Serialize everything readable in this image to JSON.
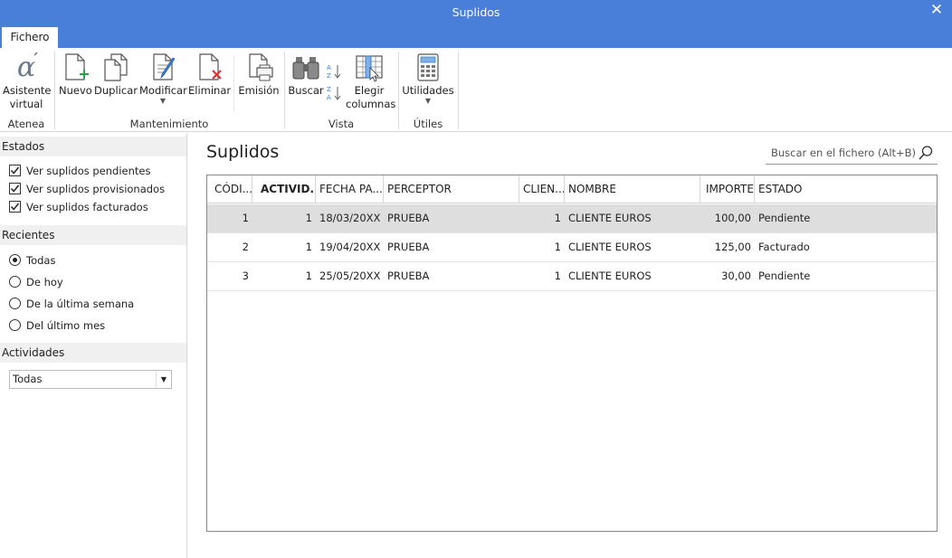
{
  "window": {
    "title": "Suplidos"
  },
  "tabs": {
    "fichero": "Fichero"
  },
  "ribbon": {
    "asistente": "Asistente\nvirtual",
    "asistente_l1": "Asistente",
    "asistente_l2": "virtual",
    "nuevo": "Nuevo",
    "duplicar": "Duplicar",
    "modificar": "Modificar",
    "eliminar": "Eliminar",
    "emision": "Emisión",
    "buscar": "Buscar",
    "elegir_l1": "Elegir",
    "elegir_l2": "columnas",
    "utilidades": "Utilidades",
    "groups": {
      "atenea": "Atenea",
      "mantenimiento": "Mantenimiento",
      "vista": "Vista",
      "utiles": "Útiles"
    }
  },
  "sidebar": {
    "estados": {
      "title": "Estados",
      "items": [
        {
          "label": "Ver suplidos pendientes",
          "checked": true
        },
        {
          "label": "Ver suplidos provisionados",
          "checked": true
        },
        {
          "label": "Ver suplidos facturados",
          "checked": true
        }
      ]
    },
    "recientes": {
      "title": "Recientes",
      "items": [
        {
          "label": "Todas",
          "selected": true
        },
        {
          "label": "De hoy",
          "selected": false
        },
        {
          "label": "De la última semana",
          "selected": false
        },
        {
          "label": "Del último mes",
          "selected": false
        }
      ]
    },
    "actividades": {
      "title": "Actividades",
      "value": "Todas"
    }
  },
  "main": {
    "title": "Suplidos",
    "search_placeholder": "Buscar en el fichero (Alt+B)",
    "columns": [
      "CÓDI...",
      "ACTIVID...",
      "FECHA PA...",
      "PERCEPTOR",
      "CLIEN...",
      "NOMBRE",
      "IMPORTE",
      "ESTADO"
    ],
    "rows": [
      {
        "codigo": "1",
        "actividad": "1",
        "fecha": "18/03/20XX",
        "perceptor": "PRUEBA",
        "cliente": "1",
        "nombre": "CLIENTE EUROS",
        "importe": "100,00",
        "estado": "Pendiente"
      },
      {
        "codigo": "2",
        "actividad": "1",
        "fecha": "19/04/20XX",
        "perceptor": "PRUEBA",
        "cliente": "1",
        "nombre": "CLIENTE EUROS",
        "importe": "125,00",
        "estado": "Facturado"
      },
      {
        "codigo": "3",
        "actividad": "1",
        "fecha": "25/05/20XX",
        "perceptor": "PRUEBA",
        "cliente": "1",
        "nombre": "CLIENTE EUROS",
        "importe": "30,00",
        "estado": "Pendiente"
      }
    ]
  },
  "colors": {
    "accent": "#4a7fd9",
    "selected_row": "#dedede"
  }
}
